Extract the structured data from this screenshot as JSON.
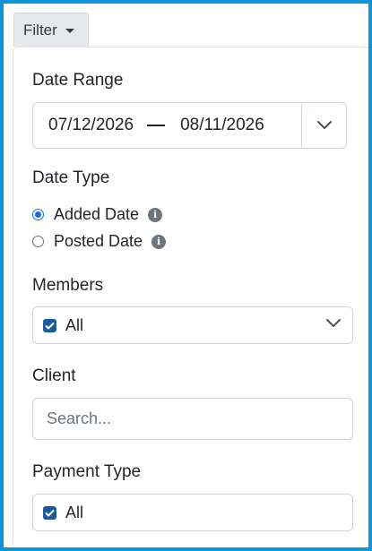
{
  "filter_button": {
    "label": "Filter"
  },
  "date_range": {
    "label": "Date Range",
    "start": "07/12/2026",
    "end": "08/11/2026"
  },
  "date_type": {
    "label": "Date Type",
    "options": [
      {
        "label": "Added Date",
        "selected": true
      },
      {
        "label": "Posted Date",
        "selected": false
      }
    ]
  },
  "members": {
    "label": "Members",
    "value": "All"
  },
  "client": {
    "label": "Client",
    "placeholder": "Search..."
  },
  "payment_type": {
    "label": "Payment Type",
    "value": "All"
  },
  "colors": {
    "accent": "#0e95dc",
    "radio": "#0d6efd",
    "checkbox": "#1a5b9e"
  }
}
